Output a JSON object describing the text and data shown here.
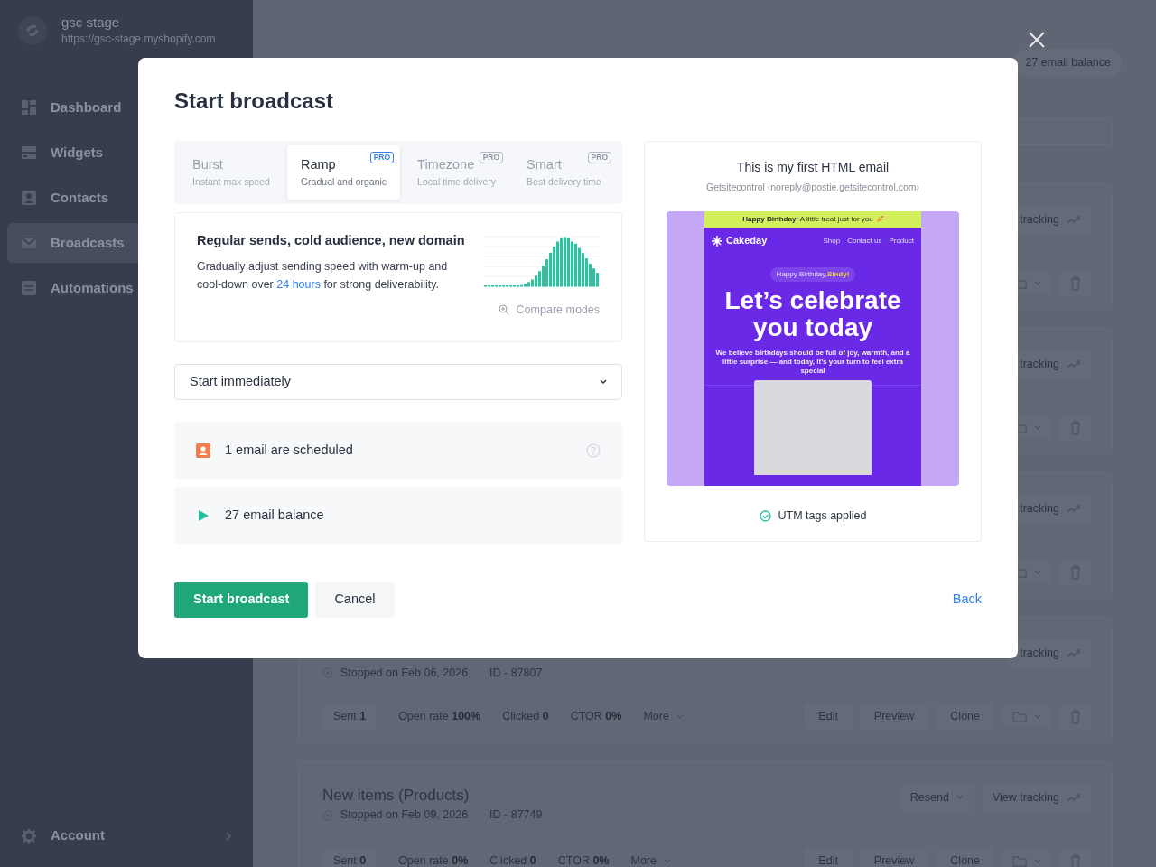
{
  "sidebar": {
    "store_name": "gsc stage",
    "store_url": "https://gsc-stage.myshopify.com",
    "items": [
      {
        "label": "Dashboard",
        "selected": false
      },
      {
        "label": "Widgets",
        "selected": false
      },
      {
        "label": "Contacts",
        "selected": false
      },
      {
        "label": "Broadcasts",
        "selected": true
      },
      {
        "label": "Automations",
        "selected": false
      }
    ],
    "account": "Account"
  },
  "main": {
    "balance": "27 email balance",
    "broadcasts": [
      {
        "view_tracking": "tracking"
      },
      {
        "view_tracking": "tracking"
      },
      {
        "view_tracking": "tracking"
      },
      {
        "view_tracking": "tracking",
        "status": "Stopped on Feb 06, 2026",
        "id": "ID - 87807",
        "stats": [
          {
            "label": "Sent",
            "value": "1"
          },
          {
            "label": "Open rate",
            "value": "100%"
          },
          {
            "label": "Clicked",
            "value": "0"
          },
          {
            "label": "CTOR",
            "value": "0%"
          }
        ],
        "more": "More",
        "actions": [
          "Edit",
          "Preview",
          "Clone"
        ]
      },
      {
        "title": "New items (Products)",
        "resend": "Resend",
        "view_tracking": "View tracking",
        "status": "Stopped on Feb 09, 2026",
        "id": "ID - 87749",
        "stats": [
          {
            "label": "Sent",
            "value": "0"
          },
          {
            "label": "Open rate",
            "value": "0%"
          },
          {
            "label": "Clicked",
            "value": "0"
          },
          {
            "label": "CTOR",
            "value": "0%"
          }
        ],
        "more": "More",
        "actions": [
          "Edit",
          "Preview",
          "Clone"
        ]
      }
    ]
  },
  "modal": {
    "title": "Start broadcast",
    "modes": [
      {
        "label": "Burst",
        "sub": "Instant max speed",
        "pro": false,
        "selected": false
      },
      {
        "label": "Ramp",
        "sub": "Gradual and organic",
        "pro": true,
        "badge": "PRO",
        "selected": true
      },
      {
        "label": "Timezone",
        "sub": "Local time delivery",
        "pro": true,
        "badge": "PRO",
        "selected": false
      },
      {
        "label": "Smart",
        "sub": "Best delivery time",
        "pro": true,
        "badge": "PRO",
        "selected": false
      }
    ],
    "description": {
      "heading": "Regular sends, cold audience, new domain",
      "before": "Gradually adjust sending speed with warm-up and cool-down over ",
      "link": "24 hours",
      "after": " for strong deliverability.",
      "compare": "Compare modes"
    },
    "schedule": {
      "value": "Start immediately"
    },
    "info_rows": [
      {
        "kind": "scheduled",
        "text": "1 email are scheduled",
        "help": true
      },
      {
        "kind": "balance",
        "text": "27 email balance",
        "help": false
      }
    ],
    "preview": {
      "subject": "This is my first HTML email",
      "sender": "Getsitecontrol ‹noreply@postie.getsitecontrol.com›",
      "email": {
        "banner": "**Happy Birthday!** A little treat just for you",
        "brand": "Cakeday",
        "nav": [
          "Shop",
          "Contact us",
          "Product"
        ],
        "greeting": "Happy Birthday,**Sindy!**",
        "headline": "Let’s celebrate you today",
        "body": "We believe birthdays should be full of joy, warmth, and a little surprise — and today, it’s your turn to feel extra special"
      },
      "utm": "UTM tags applied"
    },
    "primary": "Start broadcast",
    "cancel": "Cancel",
    "back": "Back"
  }
}
